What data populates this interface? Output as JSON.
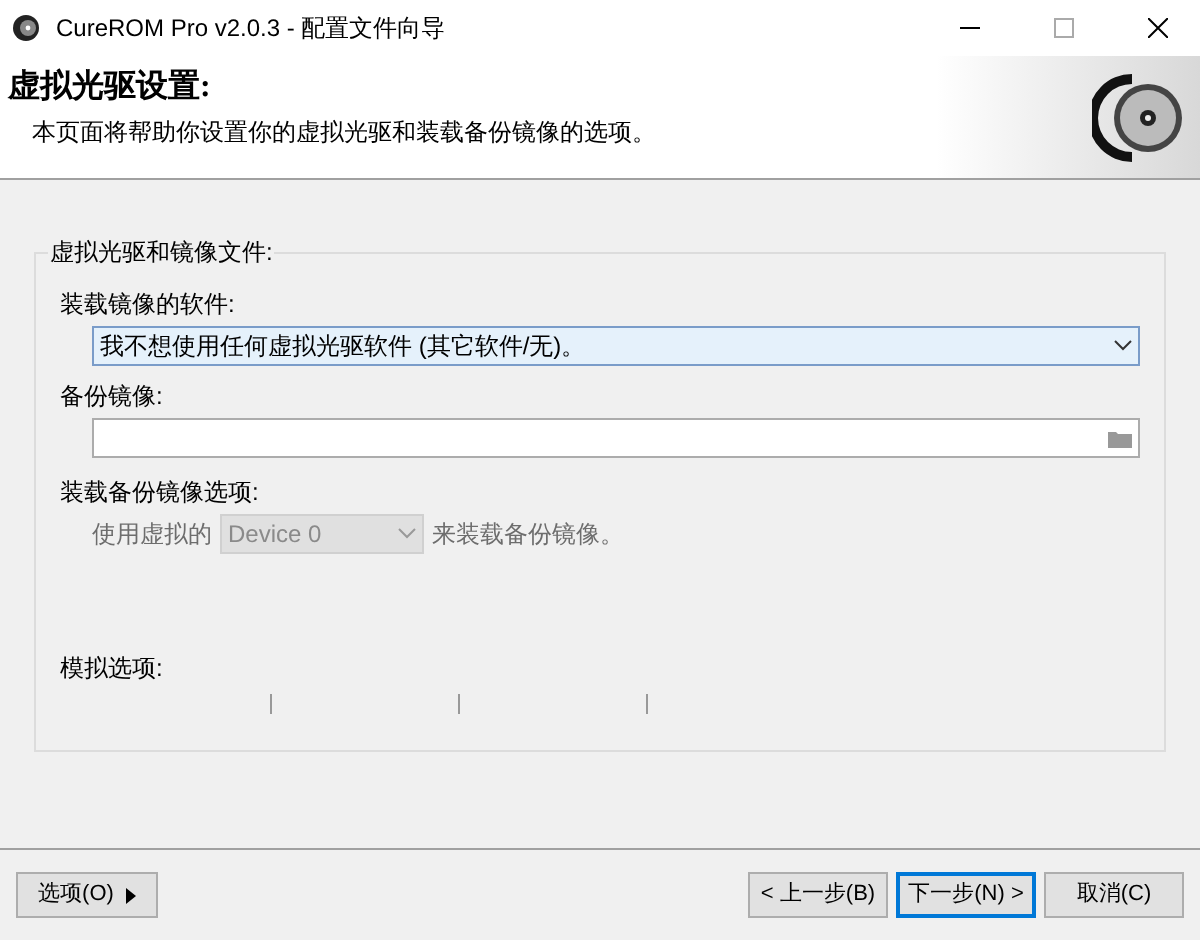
{
  "window": {
    "title": "CureROM Pro v2.0.3 - 配置文件向导"
  },
  "header": {
    "title": "虚拟光驱设置:",
    "subtitle": "本页面将帮助你设置你的虚拟光驱和装载备份镜像的选项。"
  },
  "group": {
    "title": "虚拟光驱和镜像文件:",
    "software": {
      "label": "装载镜像的软件:",
      "value": "我不想使用任何虚拟光驱软件 (其它软件/无)。"
    },
    "backup_image": {
      "label": "备份镜像:"
    },
    "mount_options": {
      "label": "装载备份镜像选项:",
      "prefix": "使用虚拟的",
      "device": {
        "value": "Device 0",
        "disabled": true
      },
      "suffix": "来装载备份镜像。"
    },
    "emulation": {
      "label": "模拟选项:"
    }
  },
  "buttons": [
    {
      "label": "选项(O)",
      "kind": "menu",
      "default": false
    },
    {
      "label": "< 上一步(B)",
      "kind": "plain",
      "default": false
    },
    {
      "label": "下一步(N) >",
      "kind": "plain",
      "default": true
    },
    {
      "label": "取消(C)",
      "kind": "plain",
      "default": false
    }
  ]
}
